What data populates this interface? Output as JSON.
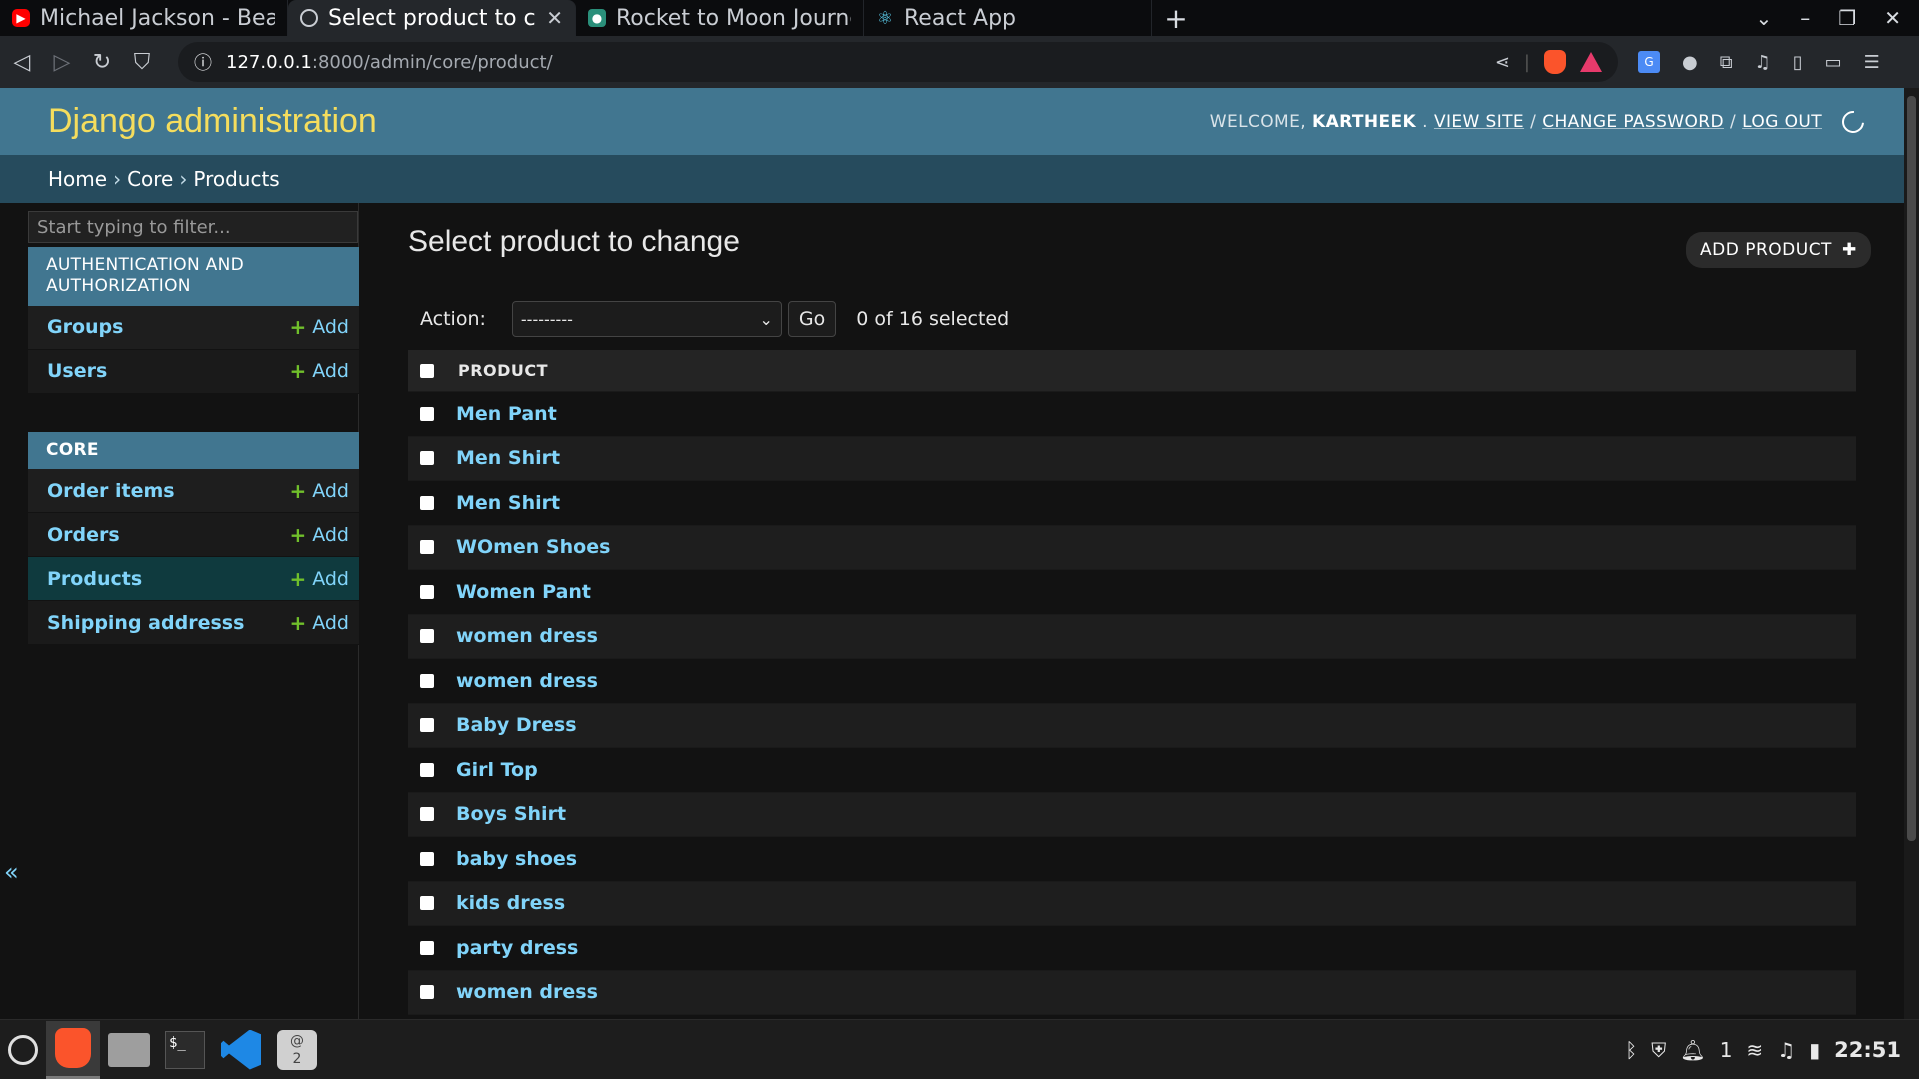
{
  "browser": {
    "tabs": [
      {
        "title": "Michael Jackson - Bea",
        "icon": "youtube-icon",
        "active": false
      },
      {
        "title": "Select product to ch",
        "icon": "globe-icon",
        "active": true
      },
      {
        "title": "Rocket to Moon Journe",
        "icon": "site-icon",
        "active": false
      },
      {
        "title": "React App",
        "icon": "react-icon",
        "active": false
      }
    ],
    "new_tab_label": "+",
    "url_host": "127.0.0.1",
    "url_path": ":8000/admin/core/product/"
  },
  "header": {
    "brand": "Django administration",
    "welcome": "WELCOME,",
    "username": "KARTHEEK",
    "view_site": "VIEW SITE",
    "change_password": "CHANGE PASSWORD",
    "log_out": "LOG OUT",
    "separator": "/"
  },
  "breadcrumbs": {
    "home": "Home",
    "app": "Core",
    "current": "Products",
    "sep": "›"
  },
  "sidebar": {
    "filter_placeholder": "Start typing to filter...",
    "modules": [
      {
        "caption": "AUTHENTICATION AND AUTHORIZATION",
        "models": [
          {
            "name": "Groups",
            "add": "Add"
          },
          {
            "name": "Users",
            "add": "Add"
          }
        ]
      },
      {
        "caption": "CORE",
        "models": [
          {
            "name": "Order items",
            "add": "Add"
          },
          {
            "name": "Orders",
            "add": "Add"
          },
          {
            "name": "Products",
            "add": "Add"
          },
          {
            "name": "Shipping addresss",
            "add": "Add"
          }
        ]
      }
    ],
    "toggle": "«"
  },
  "main": {
    "title": "Select product to change",
    "add_button": "ADD PRODUCT",
    "action_label": "Action:",
    "action_value": "---------",
    "go": "Go",
    "counter": "0 of 16 selected",
    "column_header": "PRODUCT",
    "rows": [
      "Men Pant",
      "Men Shirt",
      "Men Shirt",
      "WOmen Shoes",
      "Women Pant",
      "women dress",
      "women dress",
      "Baby Dress",
      "Girl Top",
      "Boys Shirt",
      "baby shoes",
      "kids dress",
      "party dress",
      "women dress"
    ]
  },
  "taskbar": {
    "notification_count": "1",
    "clock": "22:51",
    "mail_badge": "2"
  },
  "colors": {
    "header_bg": "#417690",
    "brand": "#f5dd5d",
    "breadcrumb_bg": "#264b5d",
    "link": "#81d4fa",
    "add_plus": "#70bf2b"
  }
}
